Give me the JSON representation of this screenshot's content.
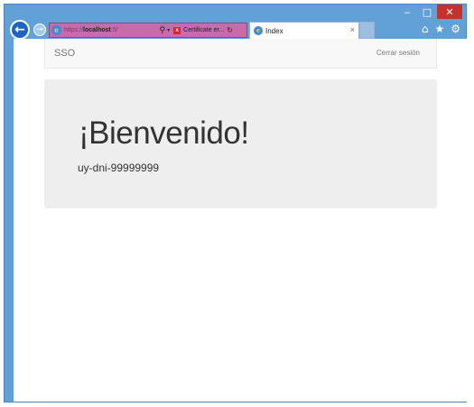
{
  "browser": {
    "window_controls": {
      "minimize": "‒",
      "maximize": "□",
      "close": "✕"
    },
    "back_icon": "←",
    "forward_icon": "→",
    "address": {
      "ie_icon": "e",
      "url_prefix": "https://",
      "url_host": "localhost",
      "url_suffix": ":5/",
      "search_icon": "⚲",
      "dropdown_icon": "▾",
      "cert_icon": "x",
      "cert_text": "Certificate er...",
      "refresh_icon": "↻"
    },
    "tab": {
      "icon": "e",
      "label": "Index",
      "close": "×"
    },
    "tools": {
      "home": "⌂",
      "favorites": "★",
      "settings": "⚙"
    }
  },
  "navbar": {
    "brand": "SSO",
    "logout": "Cerrar sesión"
  },
  "jumbotron": {
    "heading": "¡Bienvenido!",
    "user": "uy-dni-99999999"
  },
  "colors": {
    "window_frame": "#62a0d8",
    "address_bar": "#c66bab",
    "close_button": "#c7312b",
    "back_button": "#1e64c4",
    "jumbotron_bg": "#eeeeee",
    "navbar_bg": "#f8f8f8"
  }
}
